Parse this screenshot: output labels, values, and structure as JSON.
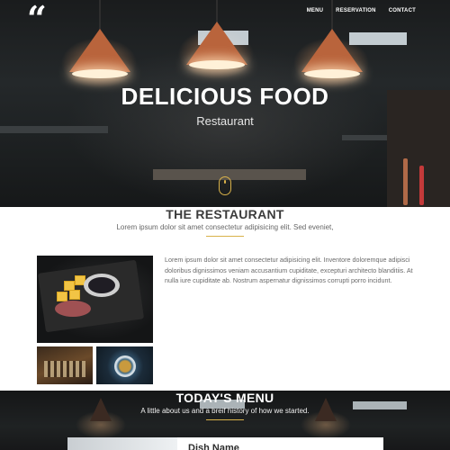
{
  "brand": {
    "logo_glyph": "“"
  },
  "nav": {
    "items": [
      {
        "label": "MENU"
      },
      {
        "label": "RESERVATION"
      },
      {
        "label": "CONTACT"
      }
    ]
  },
  "hero": {
    "title": "DELICIOUS FOOD",
    "subtitle": "Restaurant"
  },
  "restaurant": {
    "title": "THE RESTAURANT",
    "subtitle": "Lorem ipsum dolor sit amet consectetur adipisicing elit. Sed eveniet,",
    "body": "Lorem ipsum dolor sit amet consectetur adipisicing elit. Inventore doloremque adipisci doloribus dignissimos veniam accusantium cupiditate, excepturi architecto blanditiis. At nulla iure cupiditate ab. Nostrum aspernatur dignissimos corrupti porro incidunt."
  },
  "menu": {
    "title": "TODAY'S MENU",
    "subtitle": "A little about us and a breif history of how we started.",
    "dishes": [
      {
        "name": "Dish Name"
      }
    ]
  },
  "colors": {
    "accent": "#d9b24a",
    "heading": "#3b3b3b",
    "body_text": "#6a6a6a"
  }
}
